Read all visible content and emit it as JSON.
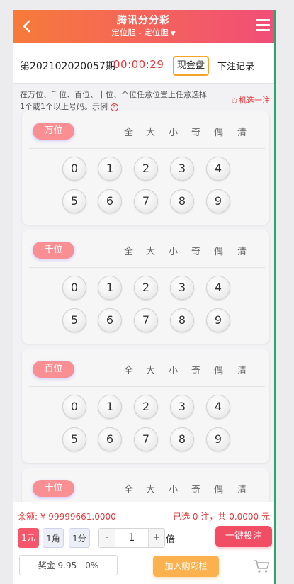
{
  "header": {
    "title": "腾讯分分彩",
    "subtitle": "定位胆 - 定位胆",
    "back_icon": "chevron-left-icon",
    "menu_icon": "hamburger-menu-icon",
    "gradient": [
      "#f77b3a",
      "#f14e78"
    ]
  },
  "period": {
    "number": "第202102020057期",
    "countdown": "00:00:29",
    "cash_label": "现金盘",
    "record_label": "下注记录"
  },
  "hint": {
    "text": "在万位、千位、百位、十位、个位任意位置上任意选择1个或1个以上号码。示例",
    "random_label": "机选一注"
  },
  "quick_picks": [
    "全",
    "大",
    "小",
    "奇",
    "偶",
    "清"
  ],
  "positions": [
    {
      "label": "万位",
      "balls": [
        "0",
        "1",
        "2",
        "3",
        "4",
        "5",
        "6",
        "7",
        "8",
        "9"
      ]
    },
    {
      "label": "千位",
      "balls": [
        "0",
        "1",
        "2",
        "3",
        "4",
        "5",
        "6",
        "7",
        "8",
        "9"
      ]
    },
    {
      "label": "百位",
      "balls": [
        "0",
        "1",
        "2",
        "3",
        "4",
        "5",
        "6",
        "7",
        "8",
        "9"
      ]
    },
    {
      "label": "十位",
      "balls": []
    }
  ],
  "footer": {
    "balance": "余额: ¥ 99999661.0000",
    "selection": "已选 0 注，共 0.0000 元",
    "units": [
      "1元",
      "1角",
      "1分"
    ],
    "active_unit": "1元",
    "stepper_minus": "-",
    "multiplier": "1",
    "stepper_plus": "+",
    "times_label": "倍",
    "bet_label": "一键投注",
    "prize": "奖金 9.95 - 0%",
    "add_cart_label": "加入购彩栏",
    "cart_icon": "shopping-cart-icon"
  },
  "colors": {
    "accent_red": "#e4393c",
    "label_pink": "#f98f92",
    "bet_button": "#f14e66",
    "cart_button": "#fbb24e",
    "cash_border": "#f3a42a"
  }
}
